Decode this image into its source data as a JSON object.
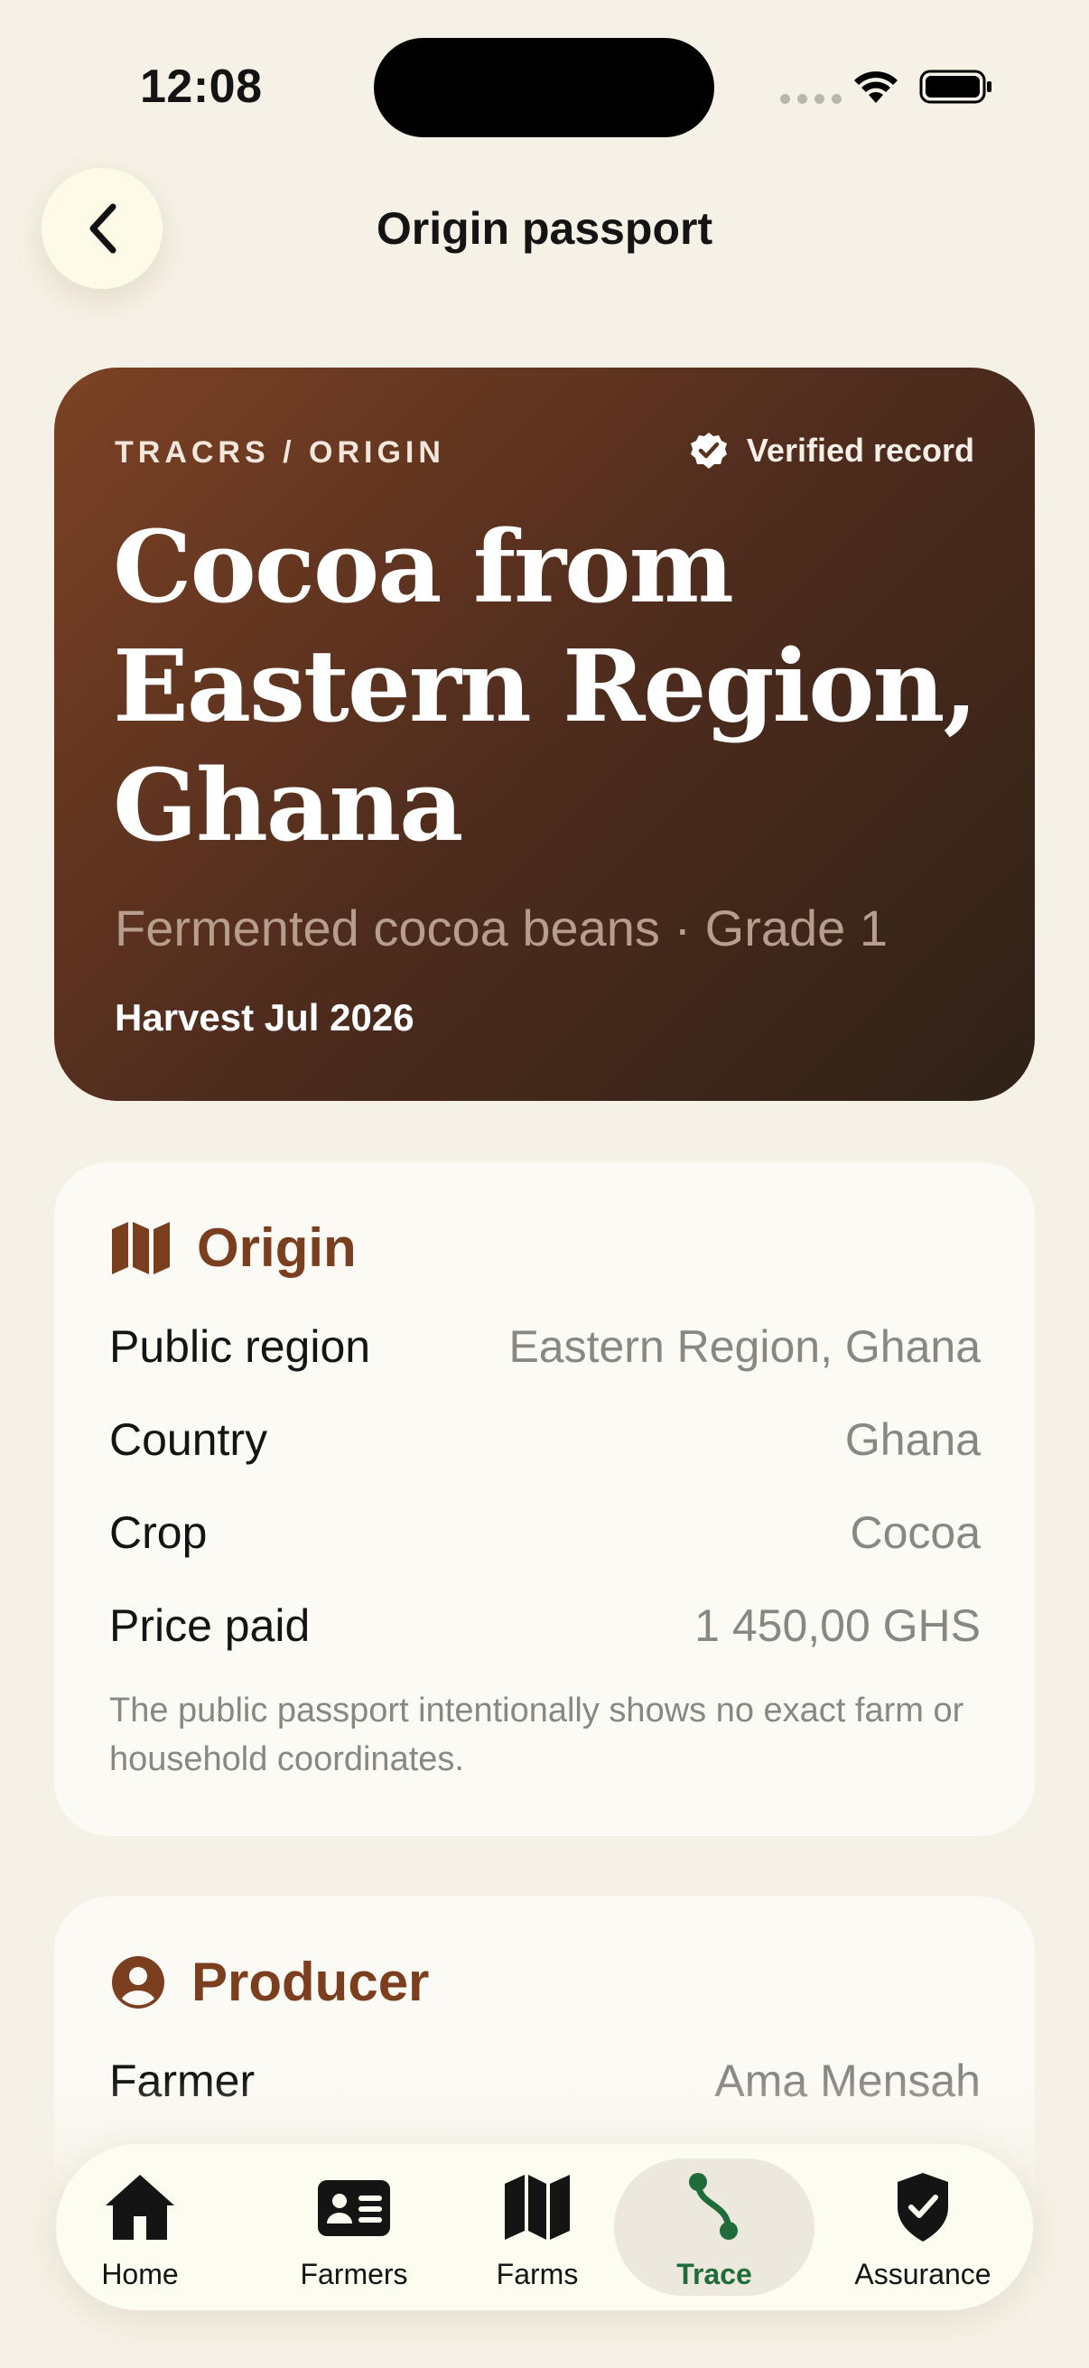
{
  "status_bar": {
    "time": "12:08"
  },
  "header": {
    "title": "Origin passport"
  },
  "hero": {
    "eyebrow": "TRACRS / ORIGIN",
    "badge": "Verified record",
    "title_lines": [
      "Cocoa from",
      "Eastern Region,",
      "Ghana"
    ],
    "subtitle": "Fermented cocoa beans · Grade 1",
    "harvest": "Harvest Jul 2026",
    "gradient": [
      "#7c4224",
      "#2e2117"
    ]
  },
  "origin": {
    "heading": "Origin",
    "rows": [
      {
        "label": "Public region",
        "value": "Eastern Region, Ghana"
      },
      {
        "label": "Country",
        "value": "Ghana"
      },
      {
        "label": "Crop",
        "value": "Cocoa"
      },
      {
        "label": "Price paid",
        "value": "1 450,00 GHS"
      }
    ],
    "note": "The public passport intentionally shows no exact farm or household coordinates."
  },
  "producer": {
    "heading": "Producer",
    "rows": [
      {
        "label": "Farmer",
        "value": "Ama Mensah"
      }
    ]
  },
  "tabbar": {
    "active": "Trace",
    "items": [
      {
        "label": "Home",
        "icon": "house-icon"
      },
      {
        "label": "Farmers",
        "icon": "id-card-icon"
      },
      {
        "label": "Farms",
        "icon": "map-icon"
      },
      {
        "label": "Trace",
        "icon": "route-icon"
      },
      {
        "label": "Assurance",
        "icon": "shield-check-icon"
      }
    ]
  },
  "colors": {
    "background": "#f6f1e6",
    "accent_brown": "#7b3e1f",
    "active_green": "#1f6b3a",
    "muted_text": "#8a8782"
  }
}
